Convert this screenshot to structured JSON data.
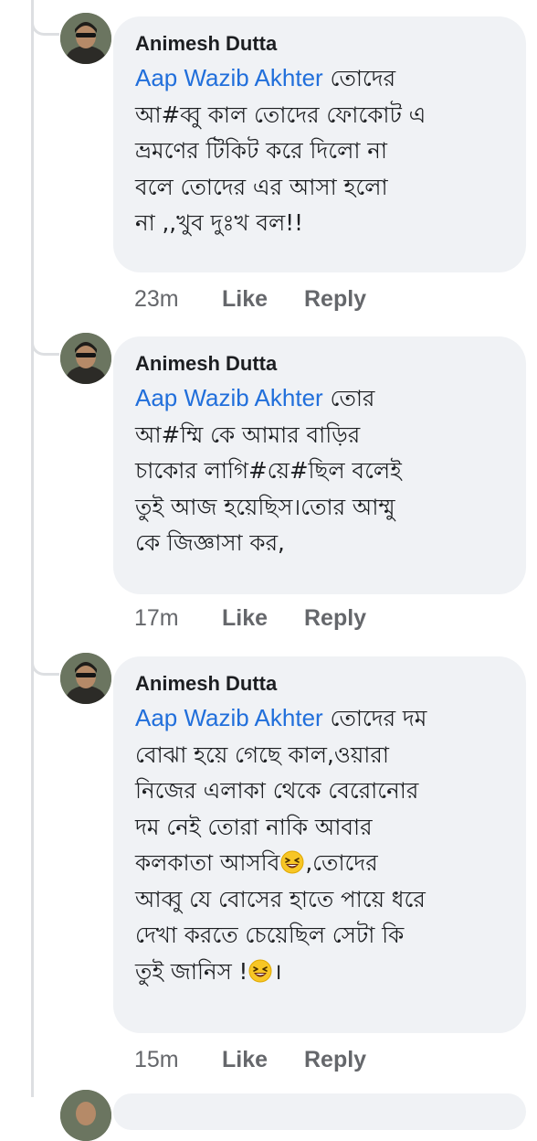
{
  "comments": [
    {
      "author": "Animesh Dutta",
      "mention": "Aap Wazib Akhter",
      "lines": [
        "তোদের",
        "আ#ব্বু কাল তোদের ফোকোট এ",
        "ভ্রমণের টিকিট করে দিলো না",
        "বলে তোদের এর আসা হলো",
        "না ,,খুব দুঃখ বল!!"
      ],
      "time": "23m",
      "like_label": "Like",
      "reply_label": "Reply"
    },
    {
      "author": "Animesh Dutta",
      "mention": "Aap Wazib Akhter",
      "lines": [
        "তোর",
        "আ#ম্মি কে আমার বাড়ির",
        "চাকোর লাগি#য়ে#ছিল বলেই",
        "তুই আজ হয়েছিস।তোর আম্মু",
        "কে জিজ্ঞাসা কর,"
      ],
      "time": "17m",
      "like_label": "Like",
      "reply_label": "Reply"
    },
    {
      "author": "Animesh Dutta",
      "mention": "Aap Wazib Akhter",
      "lines": [
        "তোদের দম",
        "বোঝা হয়ে গেছে কাল,ওয়ারা",
        "নিজের এলাকা থেকে বেরোনোর",
        "দম নেই তোরা নাকি আবার",
        "কলকাতা আসবি",
        ",তোদের",
        "আব্বু যে বোসের হাতে পায়ে ধরে",
        "দেখা করতে চেয়েছিল সেটা কি",
        "তুই জানিস !",
        "।"
      ],
      "time": "15m",
      "like_label": "Like",
      "reply_label": "Reply"
    }
  ],
  "icons": {
    "avatar": "profile-photo",
    "emoji": "laughing-face-emoji"
  },
  "colors": {
    "mention": "#216fdb",
    "bubble": "#f0f2f5",
    "meta": "#65676b"
  }
}
